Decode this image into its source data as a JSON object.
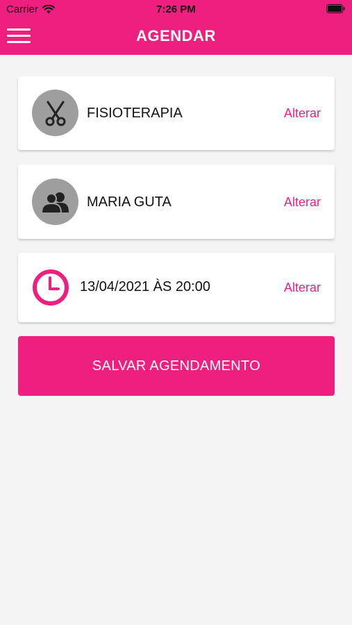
{
  "status_bar": {
    "carrier": "Carrier",
    "time": "7:26 PM"
  },
  "header": {
    "title": "AGENDAR"
  },
  "cards": [
    {
      "label": "FISIOTERAPIA",
      "action": "Alterar",
      "icon": "scissors-icon"
    },
    {
      "label": "MARIA GUTA",
      "action": "Alterar",
      "icon": "users-icon"
    },
    {
      "label": "13/04/2021 ÀS 20:00",
      "action": "Alterar",
      "icon": "clock-icon"
    }
  ],
  "save_button": {
    "label": "SALVAR AGENDAMENTO"
  },
  "colors": {
    "accent": "#ef1f7f",
    "background": "#f4f4f4",
    "icon_bg": "#9e9e9e"
  }
}
